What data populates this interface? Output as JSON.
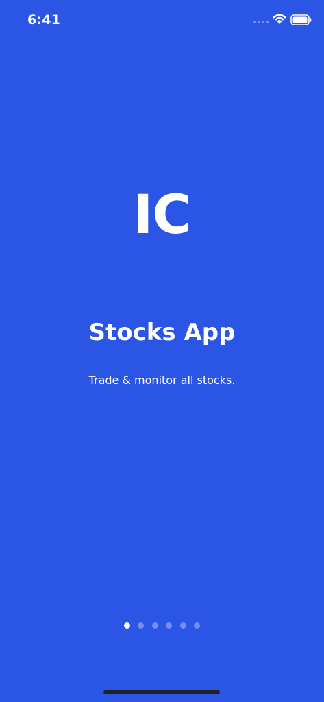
{
  "status_bar": {
    "time": "6:41",
    "icons": [
      "signal-dots-icon",
      "wifi-icon",
      "battery-icon"
    ]
  },
  "onboarding": {
    "logo_text": "IC",
    "title": "Stocks App",
    "subtitle": "Trade & monitor all stocks.",
    "pager": {
      "total_pages": 6,
      "current_page": 1
    }
  },
  "colors": {
    "background": "#2a55e5",
    "text": "#ffffff",
    "inactive_dot": "rgba(255,255,255,0.35)",
    "home_indicator": "#222222"
  }
}
